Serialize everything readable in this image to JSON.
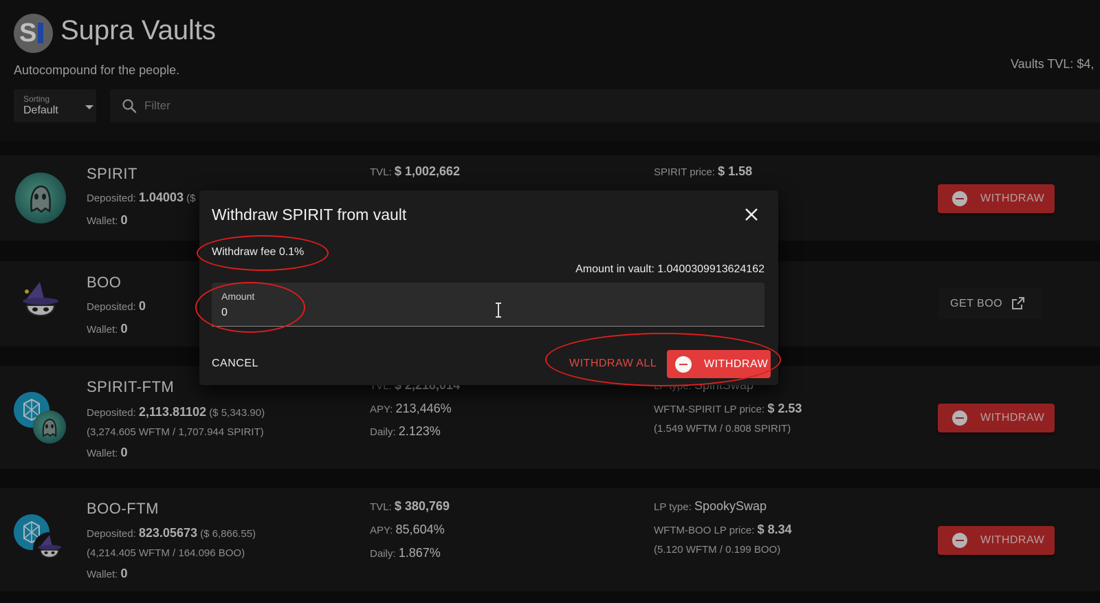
{
  "app": {
    "title": "Supra Vaults",
    "subtitle": "Autocompound for the people.",
    "tvl_total": "Vaults TVL: $4,"
  },
  "sorting": {
    "label": "Sorting",
    "value": "Default"
  },
  "filter": {
    "placeholder": "Filter"
  },
  "labels": {
    "deposited": "Deposited:",
    "wallet": "Wallet:",
    "tvl": "TVL:",
    "apy": "APY:",
    "daily": "Daily:",
    "lp_type": "LP type:",
    "withdraw": "WITHDRAW"
  },
  "vaults": [
    {
      "name": "SPIRIT",
      "deposited": "1.04003",
      "deposited_usd": "($",
      "wallet": "0",
      "tvl": "$ 1,002,662",
      "price_label": "SPIRIT price:",
      "price": "$ 1.58"
    },
    {
      "name": "BOO",
      "deposited": "0",
      "wallet": "0",
      "get_label": "GET BOO"
    },
    {
      "name": "SPIRIT-FTM",
      "deposited": "2,113.81102",
      "deposited_usd": "($ 5,343.90)",
      "underlying": "(3,274.605 WFTM / 1,707.944 SPIRIT)",
      "wallet": "0",
      "tvl": "$ 2,218,014",
      "apy": "213,446%",
      "daily": "2.123%",
      "lp_type": "SpiritSwap",
      "price_label": "WFTM-SPIRIT LP price:",
      "price": "$ 2.53",
      "price_underlying": "(1.549 WFTM / 0.808 SPIRIT)"
    },
    {
      "name": "BOO-FTM",
      "deposited": "823.05673",
      "deposited_usd": "($ 6,866.55)",
      "underlying": "(4,214.405 WFTM / 164.096 BOO)",
      "wallet": "0",
      "tvl": "$ 380,769",
      "apy": "85,604%",
      "daily": "1.867%",
      "lp_type": "SpookySwap",
      "price_label": "WFTM-BOO LP price:",
      "price": "$ 8.34",
      "price_underlying": "(5.120 WFTM / 0.199 BOO)"
    }
  ],
  "dialog": {
    "title": "Withdraw SPIRIT from vault",
    "fee": "Withdraw fee 0.1%",
    "amount_in_vault": "Amount in vault: 1.0400309913624162",
    "amount_label": "Amount",
    "amount_value": "0",
    "cancel": "CANCEL",
    "withdraw_all": "WITHDRAW ALL",
    "withdraw": "WITHDRAW"
  },
  "colors": {
    "accent_red": "#c62d2d",
    "dialog_red": "#e33b3b",
    "annotation_red": "#e11d1d",
    "background": "#0f0f0f"
  }
}
